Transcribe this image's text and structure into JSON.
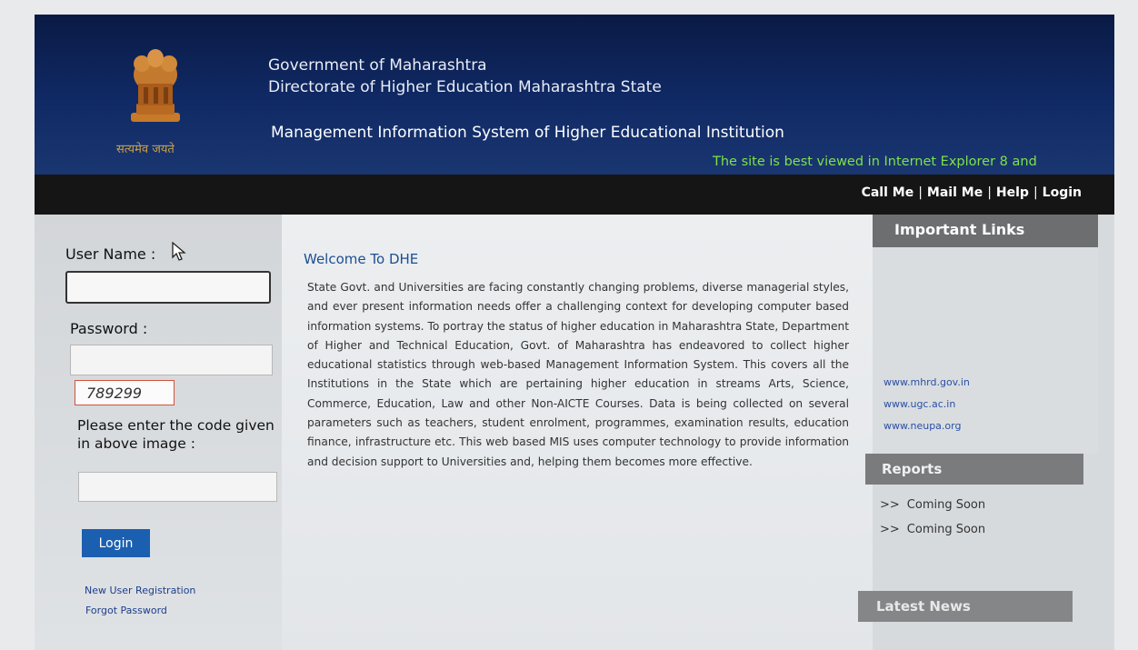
{
  "header": {
    "motto": "सत्यमेव जयते",
    "gov_line": "Government of Maharashtra",
    "directorate": "Directorate of Higher Education Maharashtra State",
    "system_title": "Management Information System of Higher Educational Institution",
    "marquee": "The site is best viewed in Internet Explorer 8 and"
  },
  "nav": {
    "call": "Call Me",
    "mail": "Mail Me",
    "help": "Help",
    "login": "Login",
    "separator": "|"
  },
  "login_form": {
    "username_label": "User Name :",
    "username_value": "",
    "password_label": "Password :",
    "password_value": "",
    "captcha_code": "789299",
    "code_label": "Please enter the code given in above image :",
    "code_value": "",
    "login_button": "Login",
    "new_user_link": "New User Registration",
    "forgot_link": "Forgot Password"
  },
  "main": {
    "welcome": "Welcome To DHE",
    "body": "State Govt. and Universities are facing constantly changing problems, diverse managerial styles, and ever present information needs offer a challenging context for developing computer based information systems. To portray the status of higher education in Maharashtra State, Department of Higher and Technical Education, Govt. of Maharashtra has endeavored to collect higher educational statistics through web-based Management Information System. This covers all the Institutions in the State which are pertaining higher education in streams Arts, Science, Commerce, Education, Law and other Non-AICTE Courses. Data is being collected on several parameters such as teachers, student enrolment, programmes, examination results, education finance, infrastructure etc. This web based MIS uses computer technology to provide information and decision support to Universities and, helping them becomes more effective."
  },
  "sidebar": {
    "important_links_title": "Important Links",
    "links": [
      "www.mhrd.gov.in",
      "www.ugc.ac.in",
      "www.neupa.org"
    ],
    "reports_title": "Reports",
    "reports": [
      {
        "arrow": ">>",
        "label": "Coming Soon"
      },
      {
        "arrow": ">>",
        "label": "Coming Soon"
      }
    ],
    "news_title": "Latest News"
  },
  "colors": {
    "header_bg": "#0a1a44",
    "marquee": "#7ee04a",
    "login_button": "#1b5fb0",
    "welcome": "#1c4f92",
    "link": "#2a4fa3"
  }
}
